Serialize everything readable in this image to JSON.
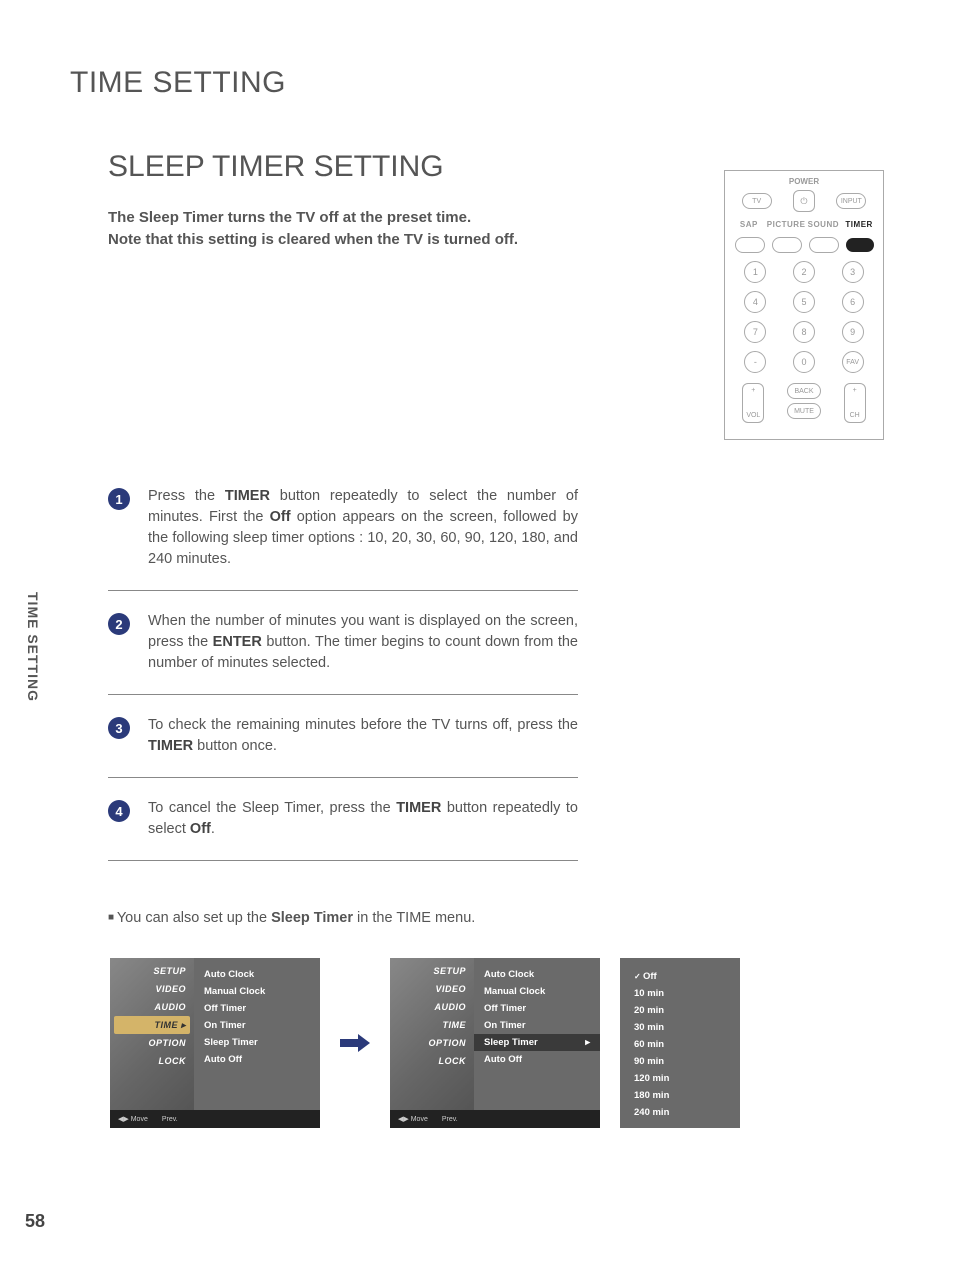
{
  "page": {
    "title": "TIME SETTING",
    "section": "SLEEP TIMER SETTING",
    "intro_line1": "The Sleep Timer turns the TV off at the preset time.",
    "intro_line2": "Note that this setting is cleared when the TV is turned off.",
    "side_tab": "TIME SETTING",
    "page_number": "58",
    "note_prefix": "You can also set up the ",
    "note_bold": "Sleep Timer",
    "note_mid": " in the ",
    "note_menu": "TIME",
    "note_suffix": " menu."
  },
  "remote": {
    "power": "POWER",
    "tv": "TV",
    "input": "INPUT",
    "sap": "SAP",
    "picture": "PICTURE",
    "sound": "SOUND",
    "timer": "TIMER",
    "digits": [
      "1",
      "2",
      "3",
      "4",
      "5",
      "6",
      "7",
      "8",
      "9",
      "-",
      "0",
      "FAV"
    ],
    "back": "BACK",
    "mute": "MUTE",
    "vol": "VOL",
    "ch": "CH",
    "plus": "+"
  },
  "steps": [
    {
      "num": "1",
      "pre": "Press the ",
      "b1": "TIMER",
      "mid1": " button repeatedly to select the number of minutes. First the ",
      "b2": "Off",
      "mid2": " option appears on the screen, followed by the following sleep timer options : 10, 20, 30, 60, 90, 120, 180, and 240 minutes."
    },
    {
      "num": "2",
      "pre": "When the number of minutes you want is displayed on the screen, press the ",
      "b1": "ENTER",
      "mid1": " button. The timer begins to count down from the number of minutes selected.",
      "b2": "",
      "mid2": ""
    },
    {
      "num": "3",
      "pre": "To check the remaining minutes before the TV turns off, press the ",
      "b1": "TIMER",
      "mid1": " button once.",
      "b2": "",
      "mid2": ""
    },
    {
      "num": "4",
      "pre": "To cancel the Sleep Timer, press the ",
      "b1": "TIMER",
      "mid1": " button repeatedly to select ",
      "b2": "Off",
      "mid2": "."
    }
  ],
  "osd": {
    "side_items": [
      "SETUP",
      "VIDEO",
      "AUDIO",
      "TIME",
      "OPTION",
      "LOCK"
    ],
    "selected": "TIME",
    "main_items": [
      "Auto Clock",
      "Manual Clock",
      "Off Timer",
      "On Timer",
      "Sleep Timer",
      "Auto Off"
    ],
    "highlight": "Sleep Timer",
    "foot_move": "Move",
    "foot_prev": "Prev.",
    "options": [
      "Off",
      "10 min",
      "20 min",
      "30 min",
      "60 min",
      "90 min",
      "120 min",
      "180 min",
      "240 min"
    ],
    "options_checked": "Off",
    "time_arrow": "▸",
    "sub_arrow": "▸"
  },
  "chart_data": null
}
